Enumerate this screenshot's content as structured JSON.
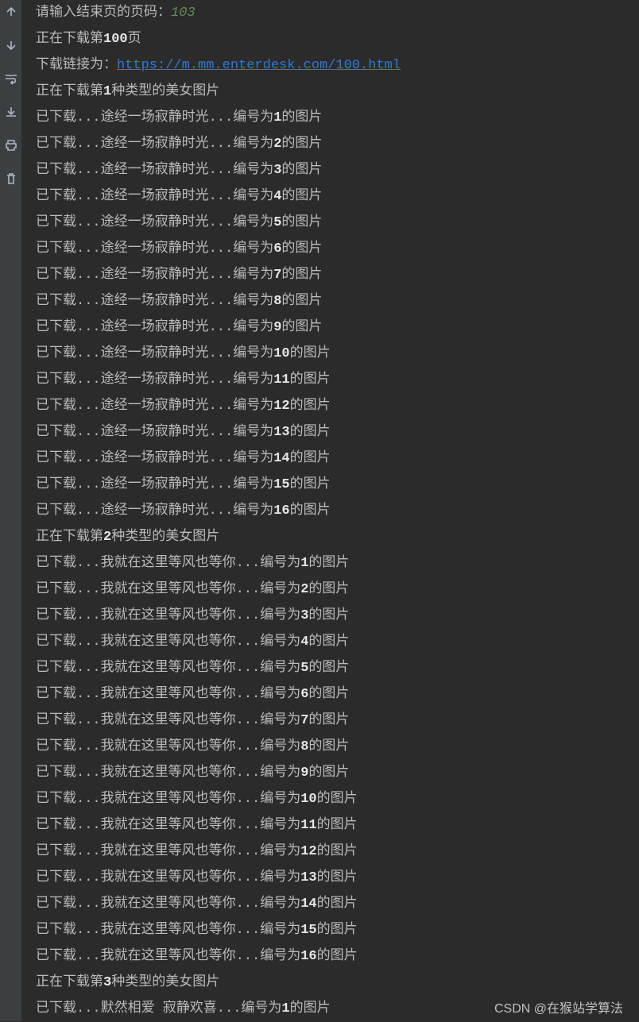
{
  "sidebar_icons": [
    "arrow-up",
    "arrow-down",
    "wrap",
    "download",
    "print",
    "delete"
  ],
  "input_prompt": {
    "prefix": "请输入结束页的页码：",
    "value": "103"
  },
  "status_page": {
    "prefix": "正在下载第",
    "num": "100",
    "suffix": "页"
  },
  "link_line": {
    "prefix": "下载链接为：",
    "url": "https://m.mm.enterdesk.com/100.html"
  },
  "link_href": "https://m.mm.enterdesk.com/100.html",
  "type_heading": {
    "prefix": "正在下载第",
    "suffix": "种类型的美女图片"
  },
  "download_line": {
    "prefix": "已下载...",
    "mid": "...编号为",
    "suffix": "的图片"
  },
  "sections": [
    {
      "type_num": "1",
      "title": "途经一场寂静时光",
      "count": 16
    },
    {
      "type_num": "2",
      "title": "我就在这里等风也等你",
      "count": 16
    },
    {
      "type_num": "3",
      "title": "默然相爱 寂静欢喜",
      "count": 1
    }
  ],
  "watermark": "CSDN @在猴站学算法"
}
